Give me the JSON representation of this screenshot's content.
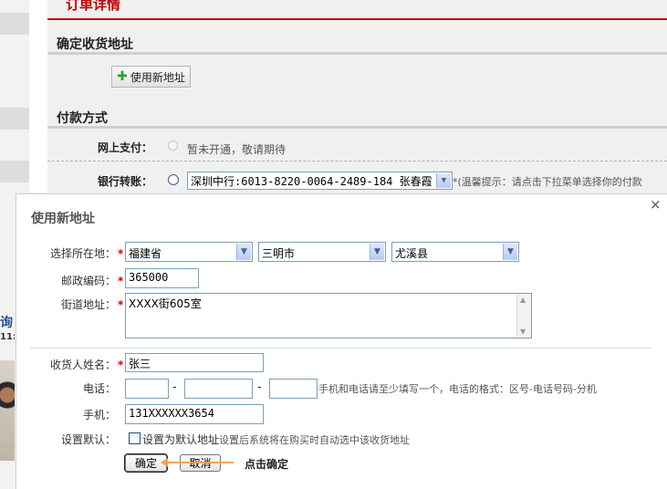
{
  "page": {
    "title": "订单详情",
    "section_address": "确定收货地址",
    "new_address_button": "使用新地址",
    "section_payment": "付款方式"
  },
  "payment": {
    "online_label": "网上支付：",
    "online_status": "暂未开通，敬请期待",
    "bank_label": "银行转账：",
    "bank_selected": "深圳中行:6013-8220-0064-2489-184 张春霞",
    "bank_tip": "*(温馨提示：请点击下拉菜单选择你的付款"
  },
  "left_fragments": {
    "text": "询",
    "time": "11:"
  },
  "dialog": {
    "title": "使用新地址",
    "close": "×",
    "region_label": "选择所在地：",
    "zip_label": "邮政编码：",
    "street_label": "街道地址：",
    "province": "福建省",
    "city": "三明市",
    "county": "尤溪县",
    "zip": "365000",
    "street": "XXXX街605室",
    "name_label": "收货人姓名：",
    "name": "张三",
    "phone_label": "电话：",
    "phone_area": "",
    "phone_number": "",
    "phone_ext": "",
    "phone_sep": "-",
    "phone_hint": "手机和电话请至少填写一个，电话的格式：区号-电话号码-分机",
    "mobile_label": "手机：",
    "mobile": "131XXXXXX3654",
    "default_label": "设置默认：",
    "default_checkbox_label": "设置为默认地址",
    "default_desc": "设置后系统将在购买时自动选中该收货地址",
    "default_checked": false,
    "required_mark": "*",
    "ok_button": "确定",
    "cancel_button": "取消"
  },
  "annotation": {
    "text": "点击确定",
    "color": "#f5a25a"
  },
  "colors": {
    "accent": "#c00000",
    "required": "#d40000",
    "link": "#1f4f9a"
  },
  "icons": {
    "new_address": "plus-icon",
    "close": "close-icon",
    "select": "chevron-down-icon"
  }
}
